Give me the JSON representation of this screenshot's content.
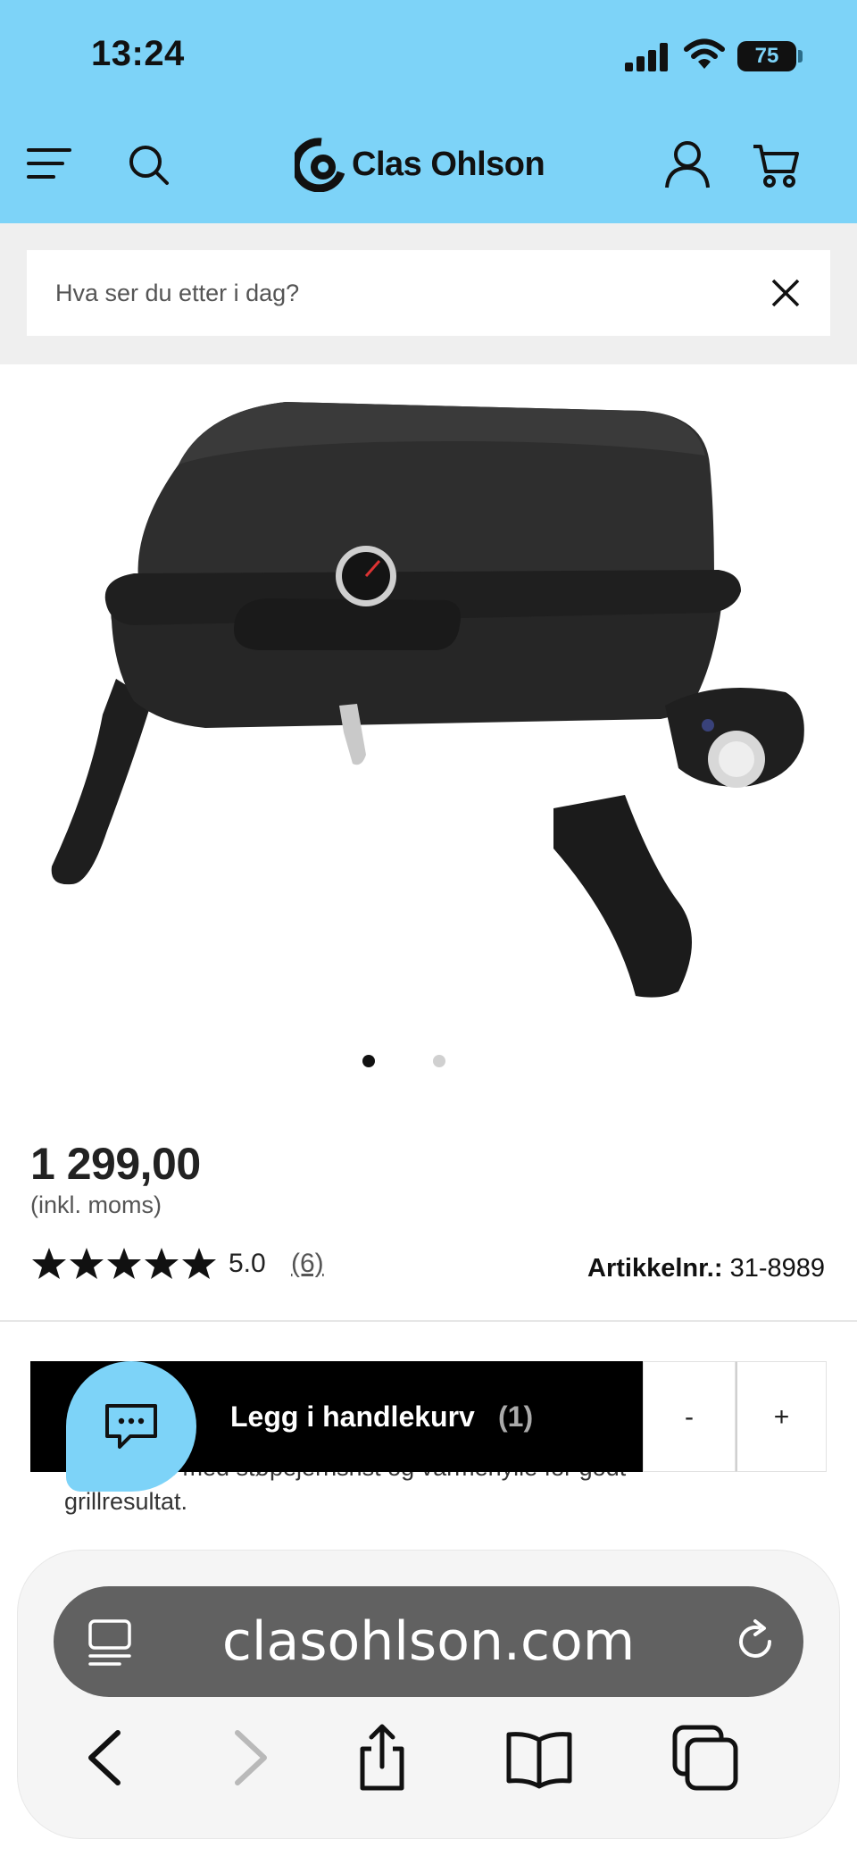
{
  "status_bar": {
    "time": "13:24",
    "battery": "75"
  },
  "header": {
    "brand": "Clas Ohlson",
    "background_color": "#7dd3f8"
  },
  "search": {
    "placeholder": "Hva ser du etter i dag?"
  },
  "gallery": {
    "image_count": 2,
    "active_index": 0
  },
  "product": {
    "price": "1 299,00",
    "vat_note": "(inkl. moms)",
    "rating": "5.0",
    "review_count": "(6)",
    "stars_filled": 5,
    "article_label": "Artikkelnr.:",
    "article_number": "31-8989"
  },
  "cart_bar": {
    "add_label": "Legg i handlekurv",
    "count": "(1)",
    "minus": "-",
    "plus": "+"
  },
  "description": {
    "line1": "• Liten grill med støpejernsrist og varmehylle for godt",
    "line2": "grillresultat."
  },
  "browser": {
    "url": "clasohlson.com"
  },
  "icons": {
    "menu": "hamburger-menu-icon",
    "search": "search-icon",
    "account": "user-icon",
    "cart": "cart-icon",
    "close": "close-icon",
    "chat": "chat-icon",
    "reader": "reader-icon",
    "reload": "reload-icon",
    "back": "back-icon",
    "forward": "forward-icon",
    "share": "share-icon",
    "bookmarks": "bookmarks-icon",
    "tabs": "tabs-icon"
  }
}
